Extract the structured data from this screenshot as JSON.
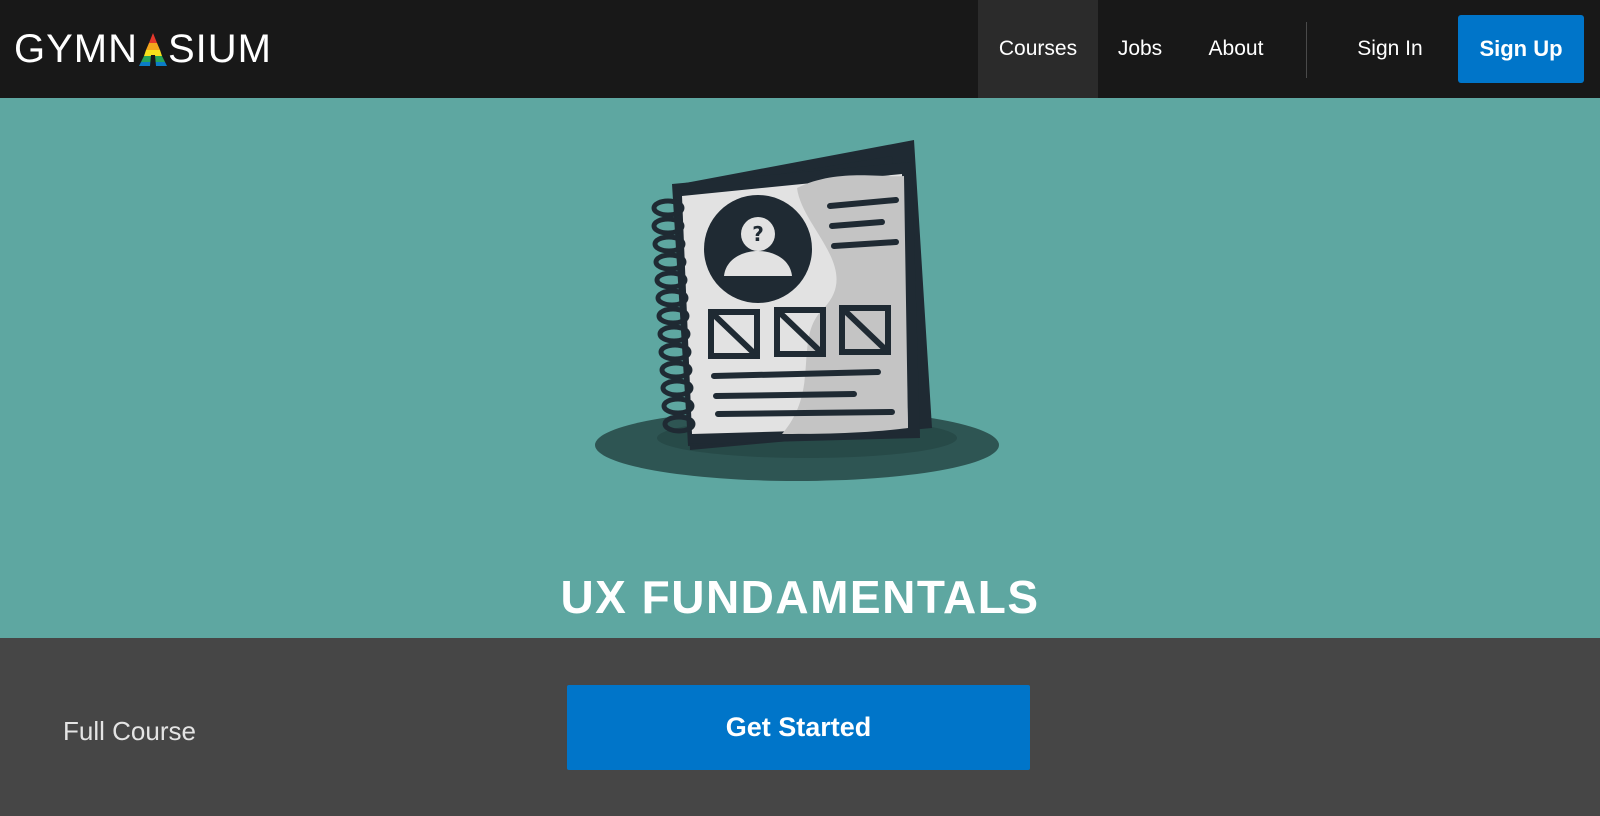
{
  "brand": {
    "logo_prefix": "GYMN",
    "logo_suffix": "SIUM",
    "accent_colors": [
      "#e5372b",
      "#f4a51c",
      "#f7e11b",
      "#27a45a",
      "#0b7dc6"
    ]
  },
  "nav": {
    "items": [
      {
        "label": "Courses",
        "active": true
      },
      {
        "label": "Jobs",
        "active": false
      },
      {
        "label": "About",
        "active": false
      }
    ],
    "sign_in": "Sign In",
    "sign_up": "Sign Up"
  },
  "hero": {
    "title": "UX FUNDAMENTALS",
    "illustration_icon": "notebook-wireframe-icon",
    "background_color": "#5ea7a1"
  },
  "cta": {
    "label": "Full Course",
    "button": "Get Started",
    "button_color": "#0075c9"
  }
}
